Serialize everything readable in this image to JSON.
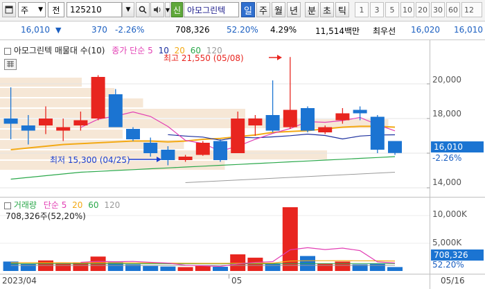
{
  "toolbar": {
    "market_select": "주",
    "period_type": "전",
    "stock_code": "125210",
    "stock_name": "아모그린텍",
    "credit_badge": "신",
    "period_tabs": [
      "일",
      "주",
      "월",
      "년",
      "분",
      "초",
      "틱"
    ],
    "active_tab": "일",
    "numbers": [
      "1",
      "3",
      "5",
      "10",
      "20",
      "30",
      "60",
      "12"
    ]
  },
  "info": {
    "price": "16,010",
    "change_arrow": "▼",
    "change": "370",
    "change_pct": "-2.26%",
    "volume": "708,326",
    "volume_ratio": "52.20%",
    "turnover": "4.29%",
    "trade_value": "11,514백만",
    "bid_label": "최우선",
    "bid": "16,020",
    "ask": "16,010"
  },
  "price_legend": {
    "title": "아모그린텍 매물대 수(10)",
    "ma_label": "종가 단순",
    "ma_periods": [
      "5",
      "10",
      "20",
      "60",
      "120"
    ]
  },
  "annotations": {
    "high": "최고 21,550 (05/08)",
    "low": "최저 15,300 (04/25)"
  },
  "price_axis": {
    "ticks": [
      "20,000",
      "18,000",
      "16,000",
      "14,000"
    ],
    "current_price": "16,010",
    "current_pct": "-2.26%"
  },
  "volume_legend": {
    "title": "거래량",
    "ma_label": "단순",
    "ma_periods": [
      "5",
      "20",
      "60",
      "120"
    ],
    "current": "708,326주(52,20%)"
  },
  "volume_axis": {
    "ticks": [
      "10,000K",
      "5,000K"
    ],
    "current": "708,326",
    "current_pct": "52.20%"
  },
  "date_axis": {
    "labels": [
      "2023/04",
      "05",
      "05/16"
    ]
  },
  "colors": {
    "up": "#e8251f",
    "down": "#1b74d2",
    "ma5": "#e23fb4",
    "ma10": "#1c2f9e",
    "ma20": "#f3a914",
    "ma60": "#2aa84a",
    "ma120": "#9a9a9a",
    "volume_profile": "#f5e3cf"
  },
  "chart_data": {
    "type": "candlestick",
    "price_range": [
      13800,
      22200
    ],
    "candles": [
      {
        "open": 18000,
        "high": 19800,
        "low": 16800,
        "close": 17700
      },
      {
        "open": 17600,
        "high": 18200,
        "low": 16500,
        "close": 17300
      },
      {
        "open": 17600,
        "high": 18700,
        "low": 17100,
        "close": 18000
      },
      {
        "open": 17300,
        "high": 18000,
        "low": 16700,
        "close": 17500
      },
      {
        "open": 17600,
        "high": 18400,
        "low": 17300,
        "close": 17900
      },
      {
        "open": 18000,
        "high": 20500,
        "low": 17900,
        "close": 20400
      },
      {
        "open": 19400,
        "high": 19700,
        "low": 17500,
        "close": 17500
      },
      {
        "open": 17400,
        "high": 17500,
        "low": 16700,
        "close": 16800
      },
      {
        "open": 16600,
        "high": 16900,
        "low": 15800,
        "close": 16000
      },
      {
        "open": 16200,
        "high": 16400,
        "low": 15300,
        "close": 15600
      },
      {
        "open": 15600,
        "high": 15900,
        "low": 15500,
        "close": 15800
      },
      {
        "open": 15900,
        "high": 16700,
        "low": 15850,
        "close": 16600
      },
      {
        "open": 16700,
        "high": 16800,
        "low": 15500,
        "close": 15600
      },
      {
        "open": 16000,
        "high": 18400,
        "low": 16000,
        "close": 18000
      },
      {
        "open": 17600,
        "high": 18200,
        "low": 17000,
        "close": 18000
      },
      {
        "open": 18200,
        "high": 20200,
        "low": 17200,
        "close": 17300
      },
      {
        "open": 17500,
        "high": 21550,
        "low": 17400,
        "close": 18500
      },
      {
        "open": 18600,
        "high": 18700,
        "low": 17200,
        "close": 17300
      },
      {
        "open": 17200,
        "high": 17600,
        "low": 17100,
        "close": 17500
      },
      {
        "open": 17900,
        "high": 18600,
        "low": 17700,
        "close": 18300
      },
      {
        "open": 18500,
        "high": 18700,
        "low": 17900,
        "close": 18300
      },
      {
        "open": 18100,
        "high": 18200,
        "low": 16000,
        "close": 16200
      },
      {
        "open": 16700,
        "high": 16700,
        "low": 15900,
        "close": 16010
      }
    ],
    "ma5": [
      null,
      null,
      null,
      null,
      17480,
      17960,
      18140,
      18380,
      18120,
      17540,
      16740,
      16560,
      16120,
      16400,
      16800,
      17140,
      17420,
      17820,
      17780,
      17880,
      18060,
      17640,
      17290
    ],
    "ma10": [
      null,
      null,
      null,
      null,
      null,
      null,
      null,
      null,
      null,
      17070,
      16990,
      16930,
      16750,
      16920,
      16890,
      16940,
      17010,
      17100,
      17020,
      16820,
      16990,
      17050,
      17060
    ],
    "ma20": [
      16200,
      16300,
      16400,
      16500,
      16550,
      16600,
      16650,
      16700,
      16700,
      16650,
      16700,
      16800,
      16850,
      16950,
      17050,
      17200,
      17250,
      17300,
      17400,
      17500,
      17550,
      17550,
      17500
    ],
    "ma60": [
      14500,
      14600,
      14700,
      14800,
      14900,
      14950,
      15000,
      15050,
      15100,
      15150,
      15200,
      15250,
      15300,
      15350,
      15400,
      15450,
      15500,
      15550,
      15600,
      15650,
      15700,
      15750,
      15800
    ],
    "ma120": [
      null,
      null,
      null,
      null,
      null,
      null,
      null,
      null,
      null,
      null,
      14300,
      14350,
      14400,
      14450,
      14500,
      14550,
      14600,
      14650,
      14700,
      14750,
      14800,
      14850,
      14900
    ],
    "volume_profile": [
      {
        "from": 15000,
        "to": 15600,
        "weight": 0.55
      },
      {
        "from": 15600,
        "to": 16200,
        "weight": 0.8
      },
      {
        "from": 16200,
        "to": 16800,
        "weight": 0.45
      },
      {
        "from": 16800,
        "to": 17400,
        "weight": 0.3
      },
      {
        "from": 17400,
        "to": 18000,
        "weight": 0.95
      },
      {
        "from": 18000,
        "to": 18600,
        "weight": 0.6
      },
      {
        "from": 18600,
        "to": 19200,
        "weight": 0.35
      },
      {
        "from": 19200,
        "to": 19800,
        "weight": 0.28
      },
      {
        "from": 19800,
        "to": 20400,
        "weight": 0.2
      }
    ],
    "volume_range": [
      0,
      12500
    ],
    "volumes": [
      1700,
      1300,
      1900,
      1400,
      1500,
      2600,
      1600,
      1200,
      900,
      800,
      700,
      900,
      750,
      3000,
      2400,
      1400,
      11500,
      2700,
      1300,
      1700,
      1200,
      1300,
      708
    ],
    "vol_ma5": [
      null,
      null,
      null,
      null,
      1560,
      1740,
      1680,
      1720,
      1560,
      1420,
      1040,
      940,
      810,
      1280,
      1550,
      1690,
      3810,
      4200,
      3860,
      4120,
      3680,
      1640,
      1440
    ],
    "vol_ma20": [
      1500,
      1500,
      1500,
      1500,
      1480,
      1500,
      1500,
      1480,
      1450,
      1420,
      1400,
      1380,
      1370,
      1400,
      1420,
      1430,
      1800,
      1850,
      1850,
      1860,
      1840,
      1830,
      1800
    ],
    "vol_ma60": [
      1300,
      1300,
      1300,
      1300,
      1300,
      1300,
      1300,
      1300,
      1300,
      1300,
      1300,
      1300,
      1300,
      1300,
      1300,
      1300,
      1350,
      1350,
      1350,
      1350,
      1350,
      1350,
      1350
    ],
    "vol_ma120": [
      1000,
      1000,
      1000,
      1000,
      1000,
      1000,
      1000,
      1000,
      1000,
      1000,
      1000,
      1000,
      1000,
      1000,
      1000,
      1000,
      1010,
      1010,
      1010,
      1010,
      1010,
      1010,
      1010
    ]
  }
}
